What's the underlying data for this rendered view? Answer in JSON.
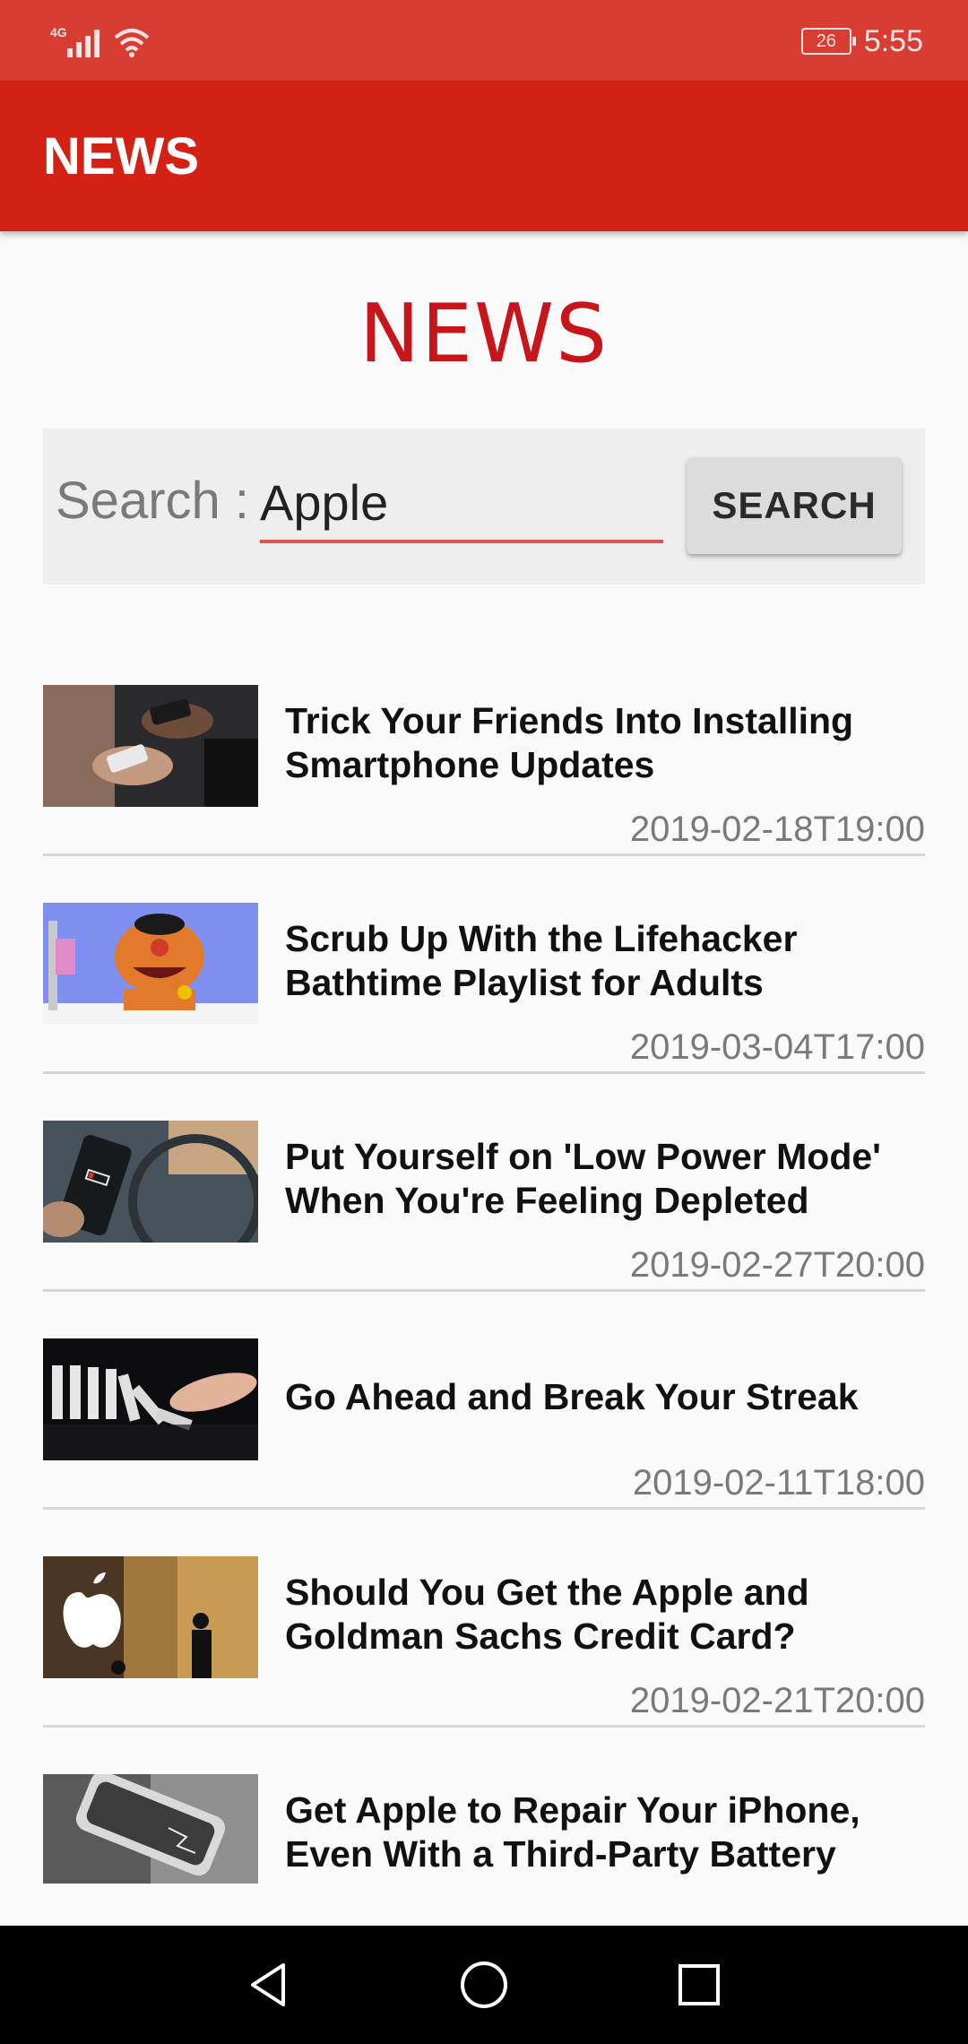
{
  "status_bar": {
    "network": "4G",
    "battery": "26",
    "time": "5:55"
  },
  "app_bar": {
    "title": "NEWS"
  },
  "hero": {
    "title": "NEWS"
  },
  "search": {
    "label": "Search :",
    "value": "Apple",
    "button_label": "SEARCH"
  },
  "news": [
    {
      "title": "Trick Your Friends Into Installing Smartphone Updates",
      "date": "2019-02-18T19:00",
      "thumb": "hands-holding-smartphones"
    },
    {
      "title": "Scrub Up With the Lifehacker Bathtime Playlist for Adults",
      "date": "2019-03-04T17:00",
      "thumb": "ernie-puppet-in-bath"
    },
    {
      "title": "Put Yourself on 'Low Power Mode' When You're Feeling Depleted",
      "date": "2019-02-27T20:00",
      "thumb": "phone-low-battery"
    },
    {
      "title": "Go Ahead and Break Your Streak",
      "date": "2019-02-11T18:00",
      "thumb": "falling-dominoes"
    },
    {
      "title": "Should You Get the Apple and Goldman Sachs Credit Card?",
      "date": "2019-02-21T20:00",
      "thumb": "apple-store-logo"
    },
    {
      "title": "Get Apple to Repair Your iPhone, Even With a Third-Party Battery",
      "date": "",
      "thumb": "broken-iphone"
    }
  ],
  "nav": {
    "back_icon": "back-triangle-icon",
    "home_icon": "home-circle-icon",
    "recents_icon": "recents-square-icon"
  }
}
